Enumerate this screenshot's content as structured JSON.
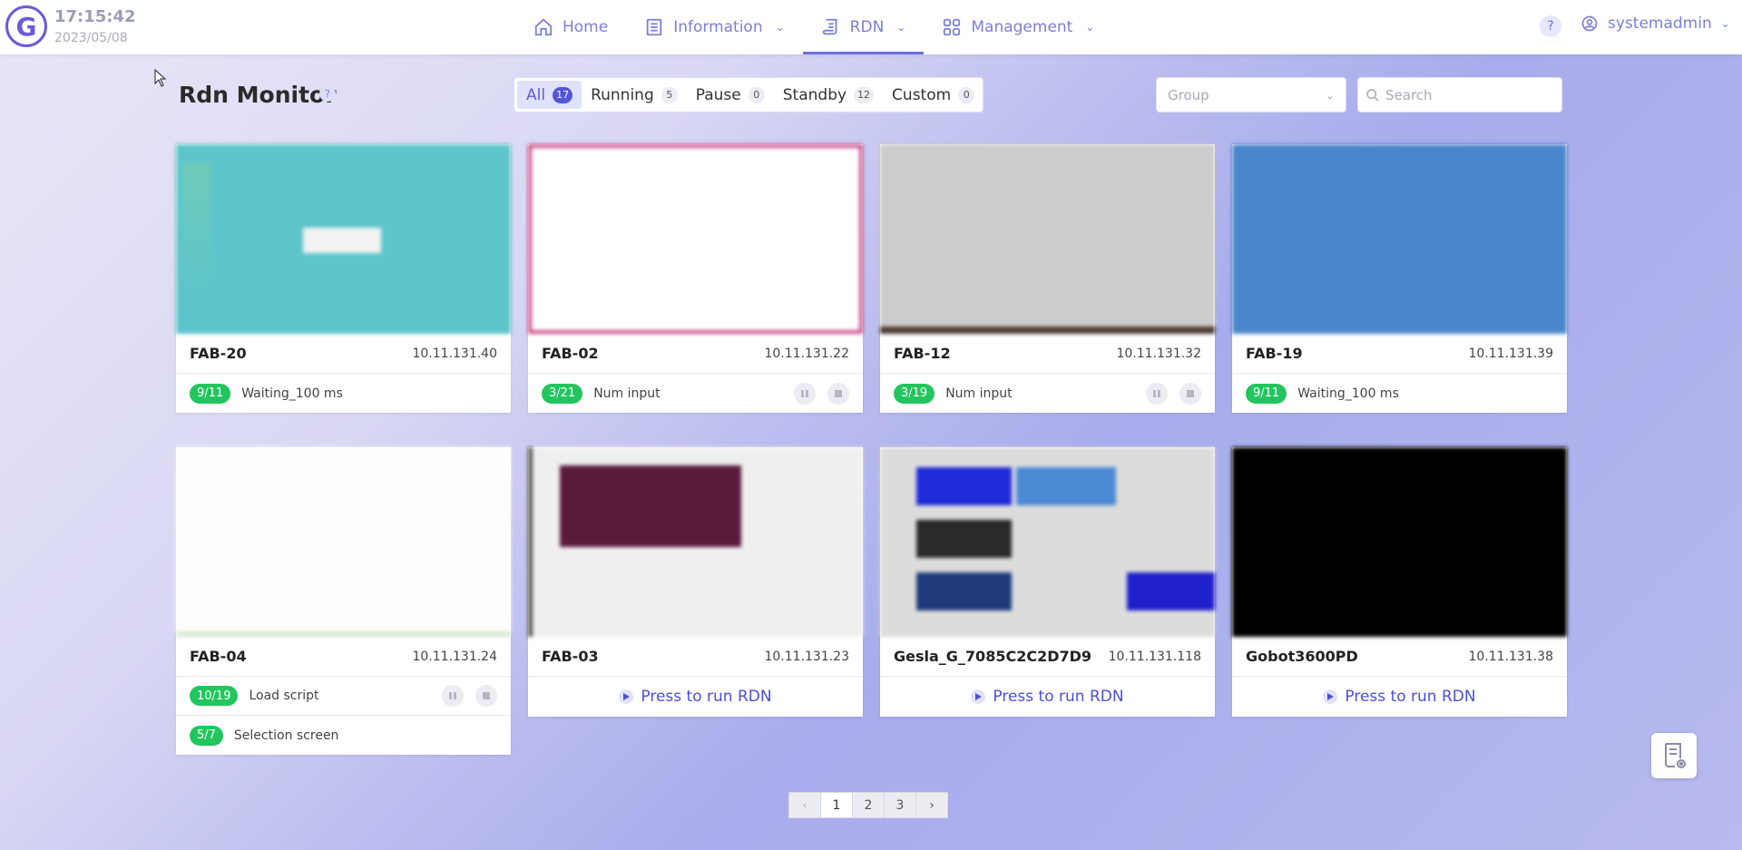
{
  "header": {
    "logo_letter": "G",
    "time": "17:15:42",
    "date": "2023/05/08",
    "nav": [
      {
        "label": "Home",
        "icon": "home-icon"
      },
      {
        "label": "Information",
        "icon": "list-icon"
      },
      {
        "label": "RDN",
        "icon": "script-icon",
        "active": true
      },
      {
        "label": "Management",
        "icon": "grid-icon"
      }
    ],
    "help": "?",
    "username": "systemadmin"
  },
  "page": {
    "title": "Rdn Monitor",
    "help": "?"
  },
  "filters": [
    {
      "label": "All",
      "count": "17",
      "active": true
    },
    {
      "label": "Running",
      "count": "5"
    },
    {
      "label": "Pause",
      "count": "0"
    },
    {
      "label": "Standby",
      "count": "12"
    },
    {
      "label": "Custom",
      "count": "0"
    }
  ],
  "group_select": {
    "placeholder": "Group"
  },
  "search": {
    "placeholder": "Search"
  },
  "cards": [
    {
      "name": "FAB-20",
      "ip": "10.11.131.40",
      "statuses": [
        {
          "pill": "9/11",
          "text": "Waiting_100 ms",
          "controls": false
        }
      ]
    },
    {
      "name": "FAB-02",
      "ip": "10.11.131.22",
      "statuses": [
        {
          "pill": "3/21",
          "text": "Num input",
          "controls": true
        }
      ]
    },
    {
      "name": "FAB-12",
      "ip": "10.11.131.32",
      "statuses": [
        {
          "pill": "3/19",
          "text": "Num input",
          "controls": true
        }
      ]
    },
    {
      "name": "FAB-19",
      "ip": "10.11.131.39",
      "statuses": [
        {
          "pill": "9/11",
          "text": "Waiting_100 ms",
          "controls": false
        }
      ]
    },
    {
      "name": "FAB-04",
      "ip": "10.11.131.24",
      "statuses": [
        {
          "pill": "10/19",
          "text": "Load script",
          "controls": true
        },
        {
          "pill": "5/7",
          "text": "Selection screen",
          "controls": false
        }
      ]
    },
    {
      "name": "FAB-03",
      "ip": "10.11.131.23",
      "run_label": "Press to run RDN"
    },
    {
      "name": "Gesla_G_7085C2C2D7D9",
      "ip": "10.11.131.118",
      "run_label": "Press to run RDN"
    },
    {
      "name": "Gobot3600PD",
      "ip": "10.11.131.38",
      "run_label": "Press to run RDN"
    }
  ],
  "pagination": {
    "pages": [
      "1",
      "2",
      "3"
    ],
    "current": "1",
    "prev": "‹",
    "next": "›"
  },
  "colors": {
    "accent": "#5b5fd8",
    "status_green": "#22c55e"
  }
}
